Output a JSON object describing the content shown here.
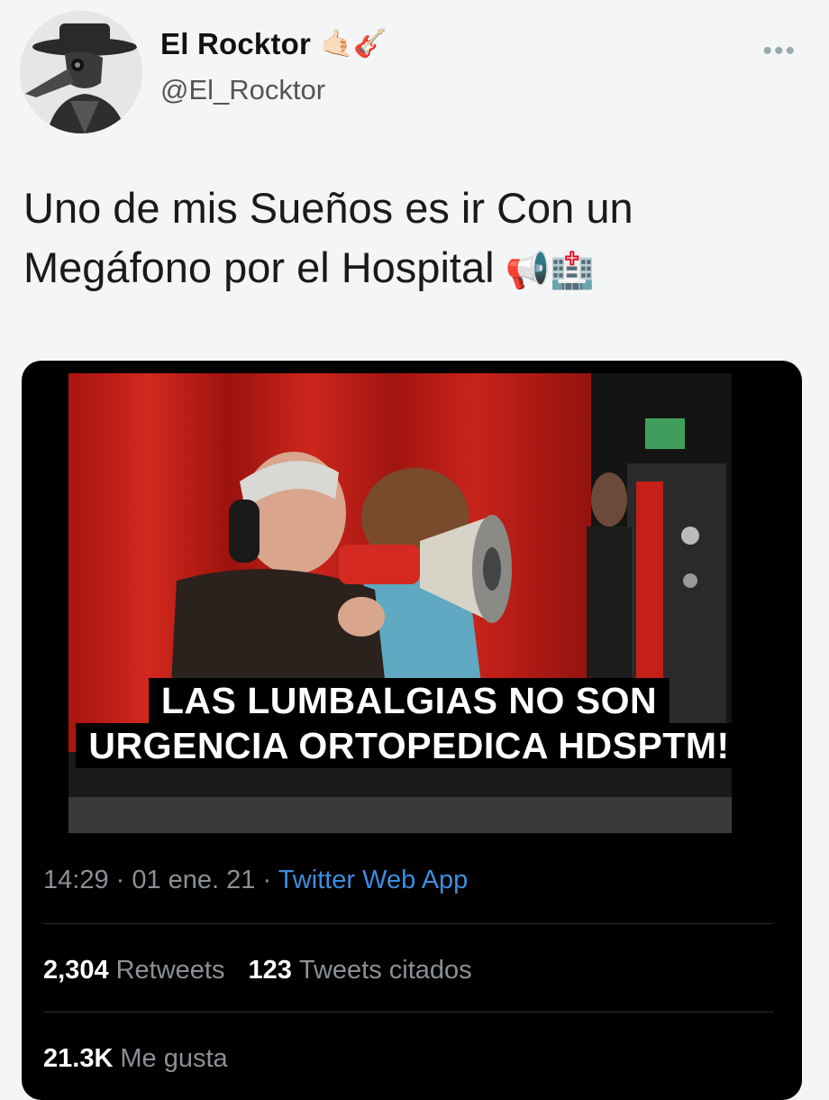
{
  "user": {
    "display_name": "El Rocktor",
    "name_emojis": "🤙🏻🎸",
    "handle": "@El_Rocktor",
    "avatar_icon": "plague-doctor-avatar"
  },
  "menu": {
    "more_label": "•••"
  },
  "tweet": {
    "text_line1": "Uno de mis Sueños es ir Con un",
    "text_line2": "Megáfono por el Hospital",
    "text_emojis": "📢🏥"
  },
  "embedded": {
    "caption_line1": "LAS LUMBALGIAS NO SON",
    "caption_line2": "URGENCIA ORTOPEDICA HDSPTM!",
    "time": "14:29",
    "date": "01 ene. 21",
    "source": "Twitter Web App",
    "separator": " · ",
    "retweets_count": "2,304",
    "retweets_label": "Retweets",
    "quotes_count": "123",
    "quotes_label": "Tweets citados",
    "likes_count": "21.3K",
    "likes_label": "Me gusta"
  },
  "colors": {
    "link_blue": "#3d8de0",
    "card_bg": "#000000",
    "page_bg": "#f4f5f6",
    "curtain_red": "#c0221c"
  }
}
